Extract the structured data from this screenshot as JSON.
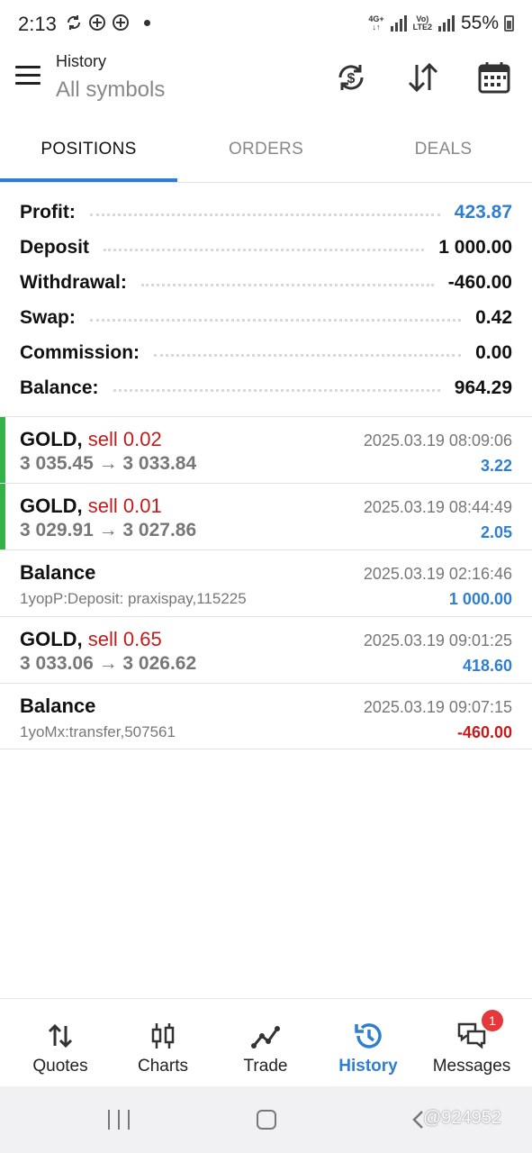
{
  "status_bar": {
    "time": "2:13",
    "network_top": "4G+",
    "network_mid": "Vo)",
    "network_bot": "LTE2",
    "battery": "55%"
  },
  "app_bar": {
    "title": "History",
    "subtitle": "All symbols",
    "actions": [
      "currency-exchange-icon",
      "sort-icon",
      "calendar-icon"
    ]
  },
  "tabs": [
    {
      "label": "POSITIONS",
      "active": true
    },
    {
      "label": "ORDERS",
      "active": false
    },
    {
      "label": "DEALS",
      "active": false
    }
  ],
  "summary": [
    {
      "label": "Profit:",
      "value": "423.87",
      "highlight": true
    },
    {
      "label": "Deposit",
      "value": "1 000.00",
      "highlight": false
    },
    {
      "label": "Withdrawal:",
      "value": "-460.00",
      "highlight": false
    },
    {
      "label": "Swap:",
      "value": "0.42",
      "highlight": false
    },
    {
      "label": "Commission:",
      "value": "0.00",
      "highlight": false
    },
    {
      "label": "Balance:",
      "value": "964.29",
      "highlight": false
    }
  ],
  "history": [
    {
      "symbol": "GOLD,",
      "side": "sell 0.02",
      "sub": "3 035.45 → 3 033.84",
      "date": "2025.03.19 08:09:06",
      "amount": "3.22",
      "negative": false,
      "marked": true,
      "type": "trade"
    },
    {
      "symbol": "GOLD,",
      "side": "sell 0.01",
      "sub": "3 029.91 → 3 027.86",
      "date": "2025.03.19 08:44:49",
      "amount": "2.05",
      "negative": false,
      "marked": true,
      "type": "trade"
    },
    {
      "symbol": "Balance",
      "side": "",
      "sub": "1yopP:Deposit: praxispay,115225",
      "date": "2025.03.19 02:16:46",
      "amount": "1 000.00",
      "negative": false,
      "marked": false,
      "type": "balance"
    },
    {
      "symbol": "GOLD,",
      "side": "sell 0.65",
      "sub": "3 033.06 → 3 026.62",
      "date": "2025.03.19 09:01:25",
      "amount": "418.60",
      "negative": false,
      "marked": false,
      "type": "trade"
    },
    {
      "symbol": "Balance",
      "side": "",
      "sub": "1yoMx:transfer,507561",
      "date": "2025.03.19 09:07:15",
      "amount": "-460.00",
      "negative": true,
      "marked": false,
      "type": "balance"
    }
  ],
  "bottom_nav": [
    {
      "label": "Quotes",
      "icon": "quotes-icon",
      "active": false
    },
    {
      "label": "Charts",
      "icon": "candlestick-icon",
      "active": false
    },
    {
      "label": "Trade",
      "icon": "trade-line-icon",
      "active": false
    },
    {
      "label": "History",
      "icon": "history-clock-icon",
      "active": true
    },
    {
      "label": "Messages",
      "icon": "messages-icon",
      "active": false,
      "badge": "1"
    }
  ],
  "watermark": "@924952",
  "colors": {
    "accent": "#2f7fd1",
    "sell": "#c41a1a",
    "marker": "#36b24a",
    "badge": "#e5383b"
  }
}
